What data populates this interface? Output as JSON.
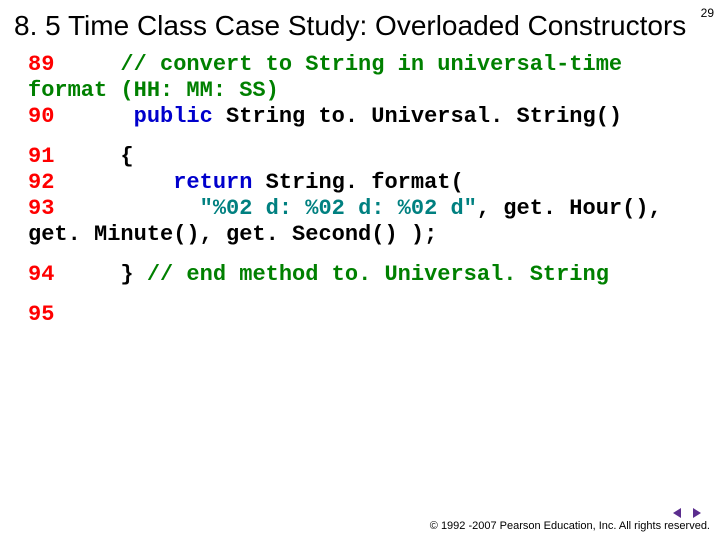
{
  "page_number": "29",
  "title": "8. 5  Time Class Case Study: Overloaded Constructors",
  "code": {
    "l89_num": "89",
    "l89_comment": "// convert to String in universal-time format (HH: MM: SS)",
    "l90_num": "90",
    "l90_kw": "public",
    "l90_rest": " String to. Universal. String()",
    "l91_num": "91",
    "l91_txt": "{",
    "l92_num": "92",
    "l92_kw": "return",
    "l92_rest": " String. format(",
    "l93_num": "93",
    "l93_str": "\"%02 d: %02 d: %02 d\"",
    "l93_after": ", get. Hour(), get. Minute(), get. Second() );",
    "l94_num": "94",
    "l94_brace": "} ",
    "l94_comment": "// end method to. Universal. String",
    "l95_num": "95"
  },
  "footer": {
    "copyright": "© 1992 -2007 Pearson Education, Inc. All rights reserved."
  }
}
